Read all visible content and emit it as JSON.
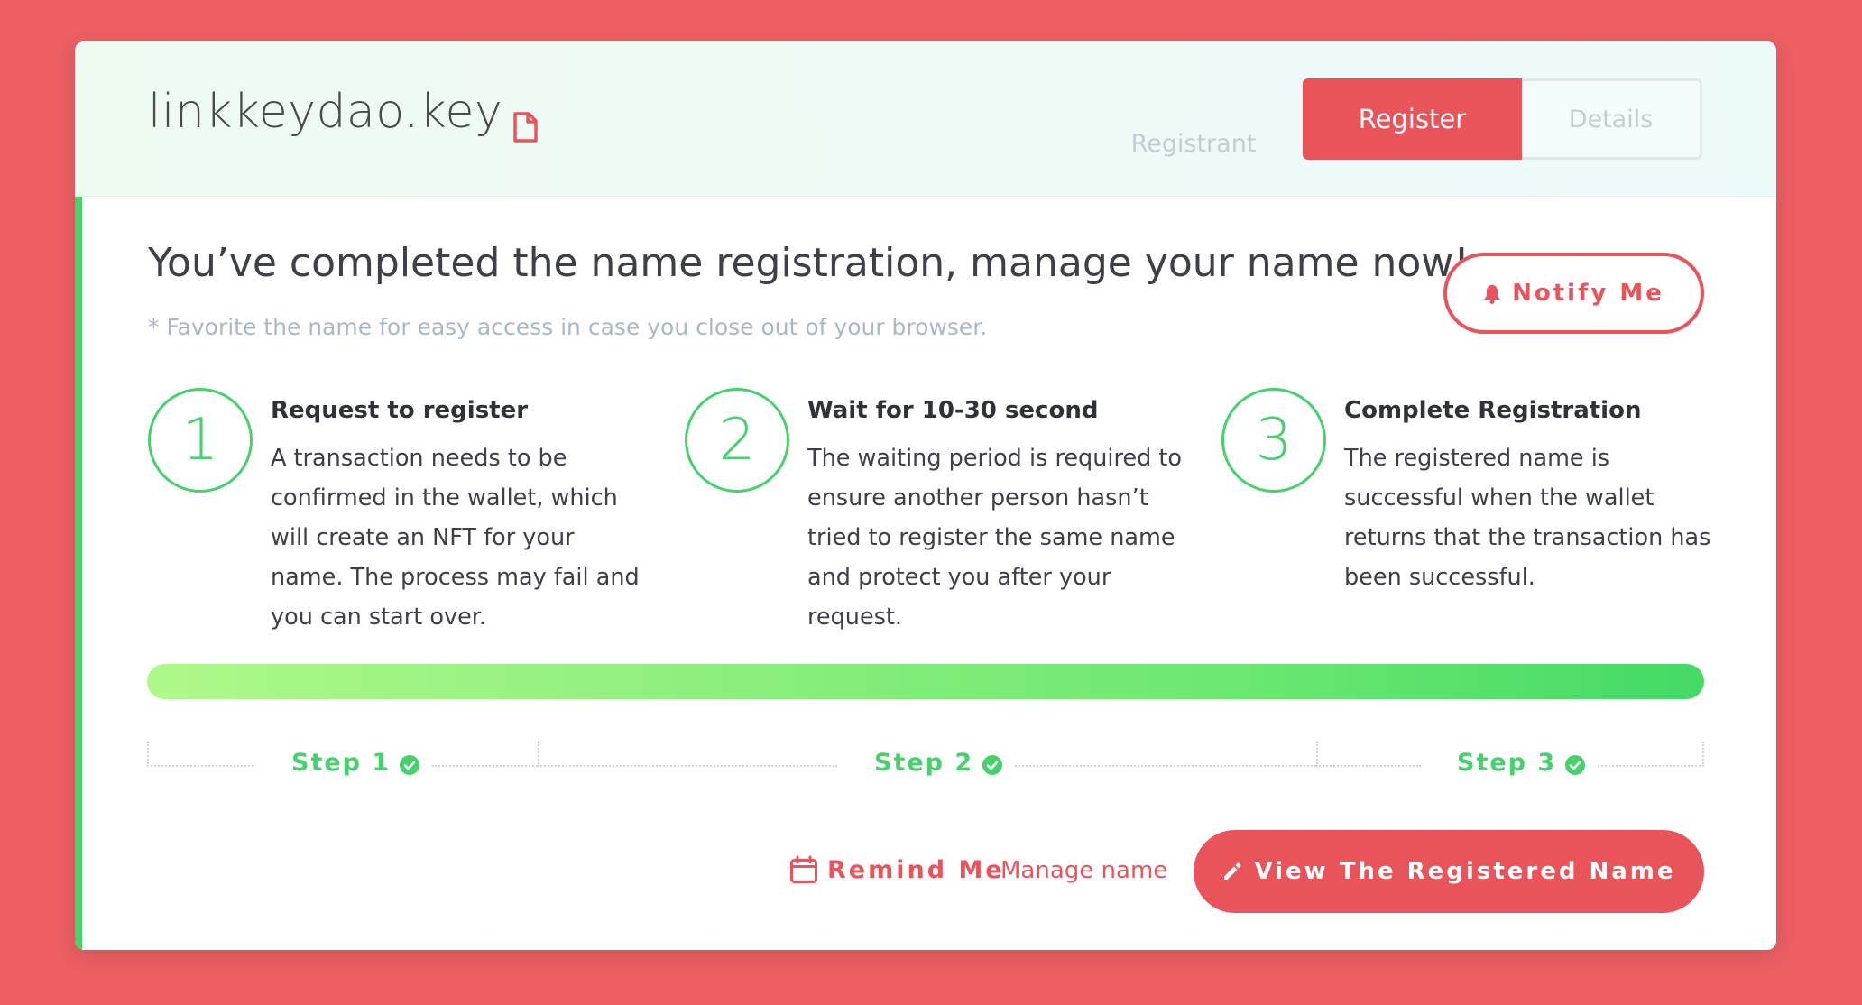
{
  "header": {
    "domain_name": "linkkeydao.key",
    "domain_icon": "document-icon",
    "tabs": [
      {
        "label": "Registrant",
        "active": false
      },
      {
        "label": "Register",
        "active": true
      },
      {
        "label": "Details",
        "active": false
      }
    ]
  },
  "main": {
    "headline": "You’ve completed the name registration, manage your name now!",
    "subnote": "* Favorite the name for easy access in case you close out of your browser.",
    "notify_label": "Notify Me",
    "notify_icon": "bell-icon",
    "steps": [
      {
        "number": "1",
        "title": "Request to register",
        "description": "A transaction needs to be confirmed in the wallet, which will create an NFT for your name. The process may fail and you can start over."
      },
      {
        "number": "2",
        "title": "Wait for 10-30 second",
        "description": "The waiting period is required to ensure another person hasn’t tried to register the same name and protect you after your request."
      },
      {
        "number": "3",
        "title": "Complete Registration",
        "description": "The registered name is successful when the wallet returns that the transaction has been successful."
      }
    ],
    "progress": {
      "value": 1.0
    },
    "step_markers": [
      {
        "label": "Step 1",
        "complete": true
      },
      {
        "label": "Step 2",
        "complete": true
      },
      {
        "label": "Step 3",
        "complete": true
      }
    ]
  },
  "footer": {
    "remind_label": "Remind Me",
    "remind_icon": "calendar-icon",
    "manage_label": "Manage name",
    "view_label": "View The Registered Name",
    "view_icon": "pencil-icon"
  },
  "colors": {
    "background": "#ec5f63",
    "accent_red": "#e9545a",
    "accent_green": "#45d26a"
  }
}
